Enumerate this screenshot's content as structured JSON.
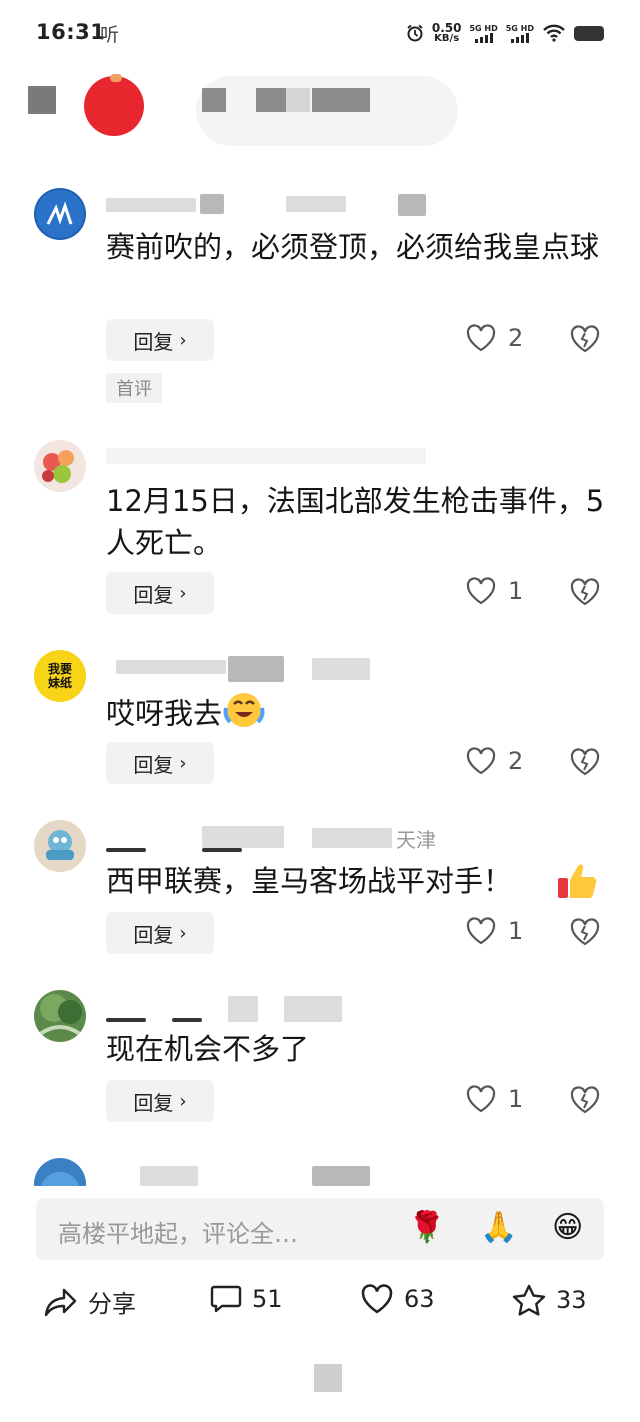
{
  "status_bar": {
    "time": "16:31",
    "listen_label": "听",
    "net_speed_value": "0.50",
    "net_speed_unit": "KB/s",
    "sim1": "5G HD",
    "sim2": "5G HD"
  },
  "comments": [
    {
      "text": "赛前吹的，必须登顶，必须给我皇点球",
      "reply_label": "回复",
      "likes": "2",
      "tag": "首评"
    },
    {
      "text": "12月15日，法国北部发生枪击事件，5人死亡。",
      "reply_label": "回复",
      "likes": "1"
    },
    {
      "avatar_text": "我要妹纸",
      "text": "哎呀我去",
      "reply_label": "回复",
      "likes": "2"
    },
    {
      "text": "西甲联赛，皇马客场战平对手！",
      "name_location": "天津",
      "reply_label": "回复",
      "likes": "1"
    },
    {
      "text": "现在机会不多了",
      "reply_label": "回复",
      "likes": "1"
    }
  ],
  "input": {
    "placeholder": "高楼平地起，评论全…",
    "quick_emojis": [
      "🌹",
      "🙏",
      "😁"
    ]
  },
  "actions": {
    "share_label": "分享",
    "comment_count": "51",
    "like_count": "63",
    "favorite_count": "33"
  }
}
